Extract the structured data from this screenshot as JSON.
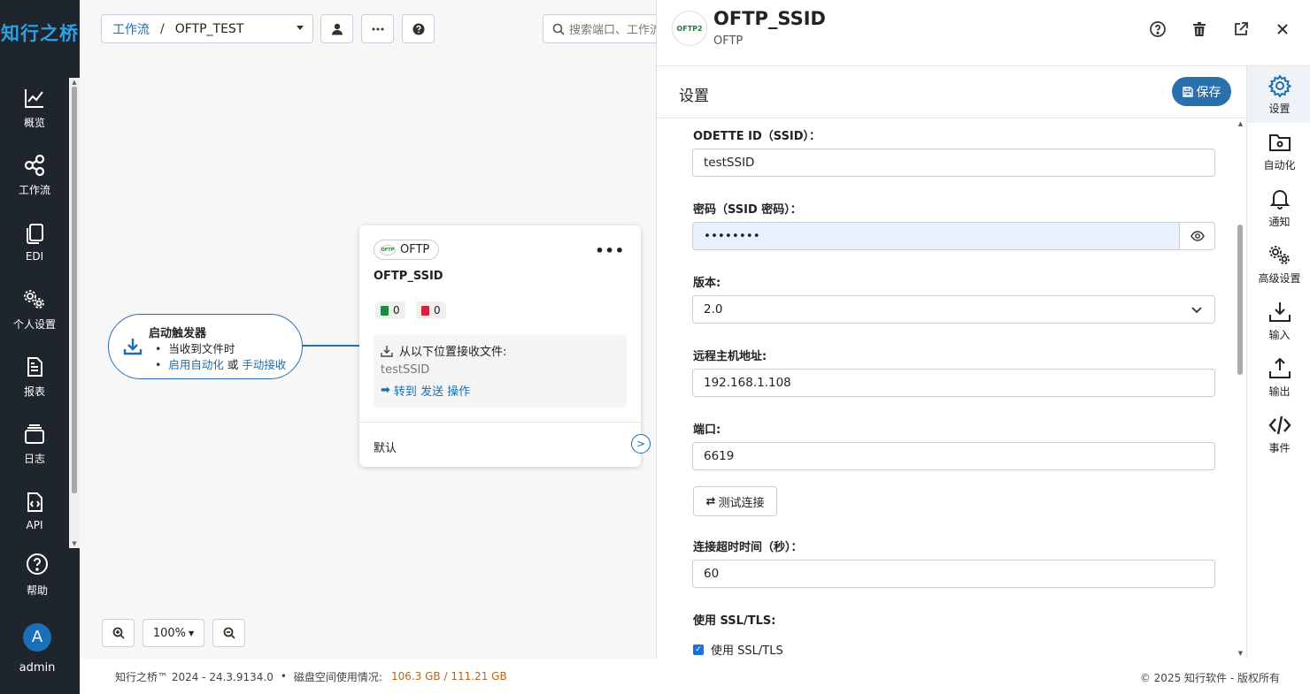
{
  "nav": {
    "logo": "知行之桥",
    "items": [
      {
        "label": "概览",
        "icon": "chart-line-icon"
      },
      {
        "label": "工作流",
        "icon": "workflow-share-icon"
      },
      {
        "label": "EDI",
        "icon": "copy-docs-icon"
      },
      {
        "label": "个人设置",
        "icon": "gears-icon"
      },
      {
        "label": "报表",
        "icon": "report-icon"
      },
      {
        "label": "日志",
        "icon": "layers-icon"
      },
      {
        "label": "API",
        "icon": "api-file-icon"
      }
    ],
    "help": "帮助",
    "user_initial": "A",
    "user_name": "admin"
  },
  "toolbar": {
    "breadcrumb_root": "工作流",
    "breadcrumb_sep": "/",
    "breadcrumb_current": "OFTP_TEST",
    "search_placeholder": "搜索端口、工作流"
  },
  "trigger": {
    "title": "启动触发器",
    "line1": "当收到文件时",
    "link1": "启用自动化",
    "or": "或",
    "link2": "手动接收"
  },
  "node": {
    "type_badge": "OFTP",
    "name": "OFTP_SSID",
    "success_count": "0",
    "error_count": "0",
    "receive_label": "从以下位置接收文件:",
    "receive_value": "testSSID",
    "goto_prefix": "转到",
    "goto_link1": "发送",
    "goto_link2": "操作",
    "default_label": "默认"
  },
  "zoom": {
    "level": "100%"
  },
  "footer": {
    "version": "知行之桥™ 2024 - 24.3.9134.0",
    "bullet": "•",
    "disk_label": "磁盘空间使用情况:",
    "disk_value": "106.3 GB / 111.21 GB",
    "copyright": "© 2025 知行软件 - 版权所有"
  },
  "panel": {
    "logo_text": "OFTP2",
    "title": "OFTP_SSID",
    "subtitle": "OFTP",
    "section_title": "设置",
    "save_label": "保存",
    "fields": {
      "ssid_label": "ODETTE ID（SSID）：",
      "ssid_value": "testSSID",
      "password_label": "密码（SSID 密码）：",
      "password_value": "••••••••",
      "version_label": "版本:",
      "version_value": "2.0",
      "host_label": "远程主机地址:",
      "host_value": "192.168.1.108",
      "port_label": "端口:",
      "port_value": "6619",
      "test_label": "测试连接",
      "timeout_label": "连接超时时间（秒）：",
      "timeout_value": "60",
      "ssl_label": "使用 SSL/TLS:",
      "ssl_checkbox": "使用 SSL/TLS"
    },
    "right_nav": [
      {
        "label": "设置",
        "icon": "gear-icon"
      },
      {
        "label": "自动化",
        "icon": "folder-gear-icon"
      },
      {
        "label": "通知",
        "icon": "bell-icon"
      },
      {
        "label": "高级设置",
        "icon": "gears-icon"
      },
      {
        "label": "输入",
        "icon": "download-tray-icon"
      },
      {
        "label": "输出",
        "icon": "upload-tray-icon"
      },
      {
        "label": "事件",
        "icon": "code-icon"
      }
    ]
  },
  "colors": {
    "nav_bg": "#1f252c",
    "accent": "#2c6fad",
    "link": "#1a6fb0"
  }
}
